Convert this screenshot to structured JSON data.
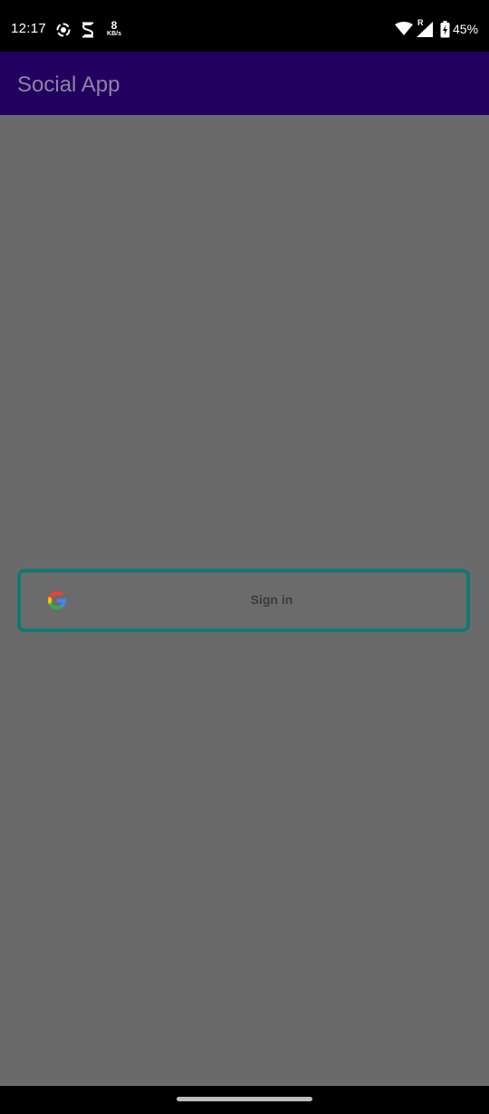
{
  "status_bar": {
    "time": "12:17",
    "net_speed_value": "8",
    "net_speed_unit": "KB/s",
    "roaming_indicator": "R",
    "battery_percent": "45%",
    "icons": [
      "screen-record-icon",
      "s-app-icon",
      "wifi-icon",
      "signal-icon",
      "battery-charging-icon"
    ]
  },
  "app_bar": {
    "title": "Social App",
    "background_color": "#22005f"
  },
  "main": {
    "sign_in_button": {
      "label": "Sign in",
      "icon": "google-icon",
      "border_color": "#0f7a70"
    }
  },
  "colors": {
    "scrim": "#6a6a6a",
    "google_blue": "#4285F4",
    "google_red": "#EA4335",
    "google_yellow": "#FBBC05",
    "google_green": "#34A853"
  }
}
